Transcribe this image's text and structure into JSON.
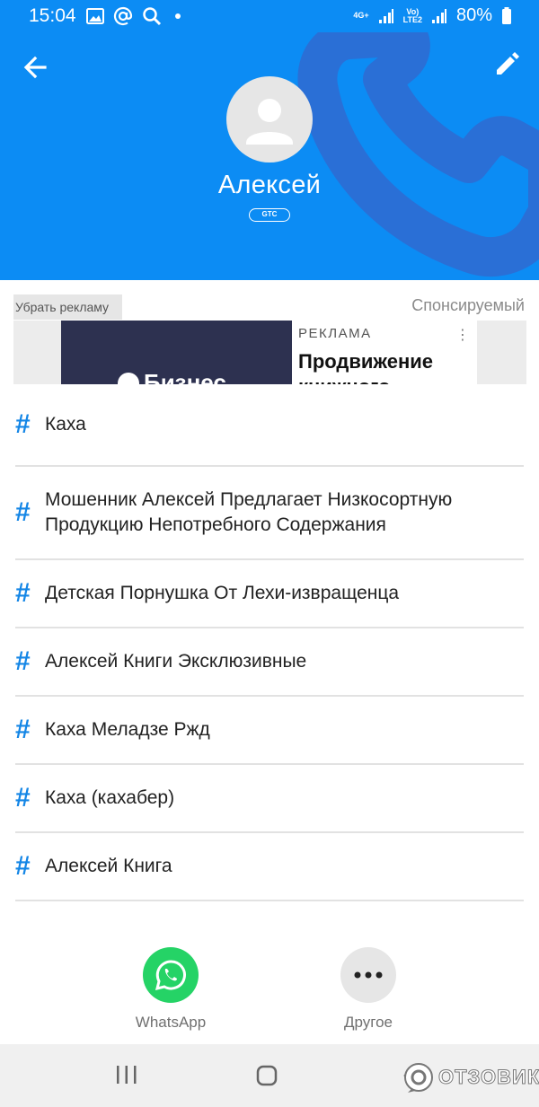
{
  "status_bar": {
    "time": "15:04",
    "network_top": "4G+",
    "volte_top": "Vo)",
    "volte_bottom": "LTE2",
    "battery": "80%"
  },
  "header": {
    "contact_name": "Алексей",
    "carrier": "GTC",
    "colors": {
      "background": "#0c8cf4",
      "phone_watermark": "#2a6fd6"
    }
  },
  "ad": {
    "remove_ad_label": "Убрать рекламу",
    "sponsored_label": "Спонсируемый",
    "image_text": "Бизнес",
    "ad_label": "РЕКЛАМА",
    "menu_icon": "⋮",
    "title": "Продвижение книжного"
  },
  "tags": [
    {
      "hash": "#",
      "text": "Каха"
    },
    {
      "hash": "#",
      "text": "Мошенник Алексей Предлагает Низкосортную Продукцию Непотребного Содержания"
    },
    {
      "hash": "#",
      "text": "Детская Порнушка От Лехи-извращенца"
    },
    {
      "hash": "#",
      "text": "Алексей Книги Эксклюзивные"
    },
    {
      "hash": "#",
      "text": "Каха Меладзе Ржд"
    },
    {
      "hash": "#",
      "text": "Каха (кахабер)"
    },
    {
      "hash": "#",
      "text": "Алексей Книга"
    }
  ],
  "actions": [
    {
      "label": "WhatsApp",
      "icon": "whatsapp-icon",
      "color": "#25d366"
    },
    {
      "label": "Другое",
      "icon": "more-icon",
      "color": "#e6e6e6"
    }
  ],
  "watermark": {
    "text": "ОТЗОВИК"
  }
}
